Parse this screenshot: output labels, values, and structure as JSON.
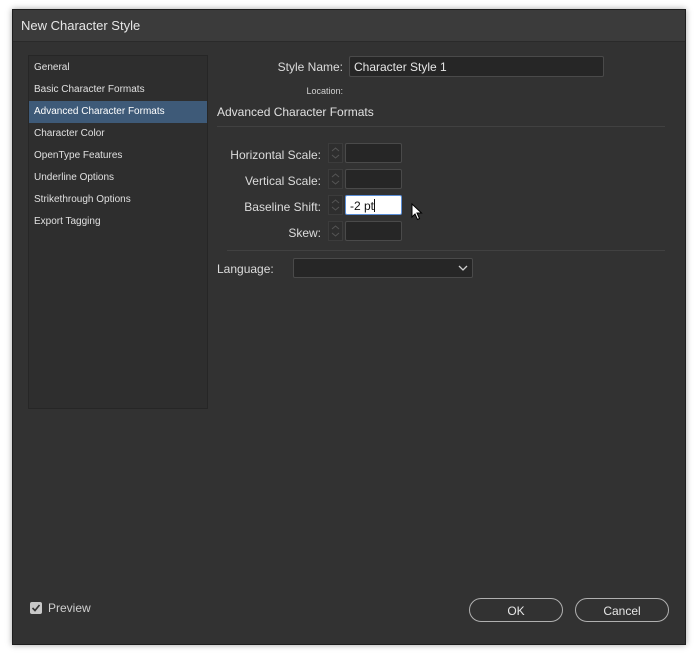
{
  "window": {
    "title": "New Character Style"
  },
  "sidebar": {
    "items": [
      {
        "label": "General"
      },
      {
        "label": "Basic Character Formats"
      },
      {
        "label": "Advanced Character Formats"
      },
      {
        "label": "Character Color"
      },
      {
        "label": "OpenType Features"
      },
      {
        "label": "Underline Options"
      },
      {
        "label": "Strikethrough Options"
      },
      {
        "label": "Export Tagging"
      }
    ],
    "selected": "Advanced Character Formats"
  },
  "style_name": {
    "label": "Style Name:",
    "value": "Character Style 1"
  },
  "location": {
    "label": "Location:",
    "value": ""
  },
  "section": {
    "title": "Advanced Character Formats"
  },
  "fields": {
    "horizontal_scale": {
      "label": "Horizontal Scale:",
      "value": ""
    },
    "vertical_scale": {
      "label": "Vertical Scale:",
      "value": ""
    },
    "baseline_shift": {
      "label": "Baseline Shift:",
      "value": "-2 pt"
    },
    "skew": {
      "label": "Skew:",
      "value": ""
    }
  },
  "language": {
    "label": "Language:",
    "value": ""
  },
  "preview": {
    "label": "Preview",
    "checked": true
  },
  "buttons": {
    "ok": "OK",
    "cancel": "Cancel"
  },
  "colors": {
    "dialog_bg": "#323232",
    "selection": "#3e5a78",
    "focus_border": "#5b8ed6"
  }
}
